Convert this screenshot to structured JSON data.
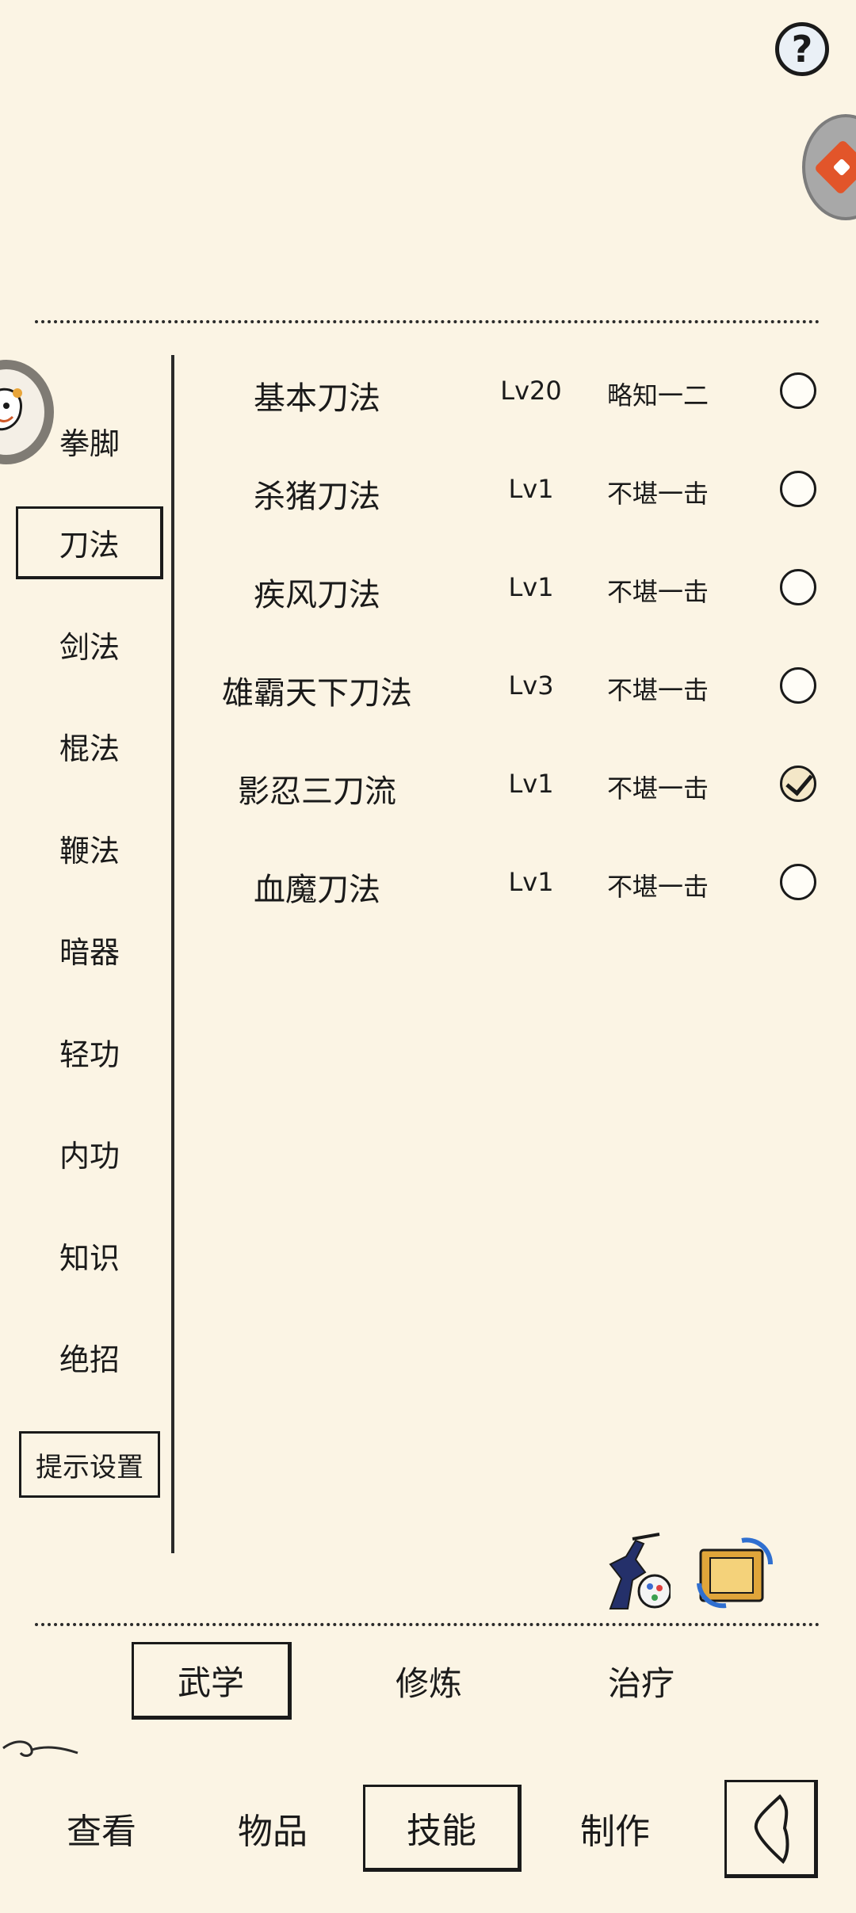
{
  "header": {
    "help_label": "?"
  },
  "categories": [
    {
      "label": "拳脚",
      "selected": false
    },
    {
      "label": "刀法",
      "selected": true
    },
    {
      "label": "剑法",
      "selected": false
    },
    {
      "label": "棍法",
      "selected": false
    },
    {
      "label": "鞭法",
      "selected": false
    },
    {
      "label": "暗器",
      "selected": false
    },
    {
      "label": "轻功",
      "selected": false
    },
    {
      "label": "内功",
      "selected": false
    },
    {
      "label": "知识",
      "selected": false
    },
    {
      "label": "绝招",
      "selected": false
    }
  ],
  "hint_settings_label": "提示设置",
  "skills": [
    {
      "name": "基本刀法",
      "level": "Lv20",
      "mastery": "略知一二",
      "checked": false
    },
    {
      "name": "杀猪刀法",
      "level": "Lv1",
      "mastery": "不堪一击",
      "checked": false
    },
    {
      "name": "疾风刀法",
      "level": "Lv1",
      "mastery": "不堪一击",
      "checked": false
    },
    {
      "name": "雄霸天下刀法",
      "level": "Lv3",
      "mastery": "不堪一击",
      "checked": false
    },
    {
      "name": "影忍三刀流",
      "level": "Lv1",
      "mastery": "不堪一击",
      "checked": true
    },
    {
      "name": "血魔刀法",
      "level": "Lv1",
      "mastery": "不堪一击",
      "checked": false
    }
  ],
  "sub_tabs": [
    {
      "label": "武学",
      "selected": true
    },
    {
      "label": "修炼",
      "selected": false
    },
    {
      "label": "治疗",
      "selected": false
    }
  ],
  "main_tabs": [
    {
      "label": "查看",
      "selected": false
    },
    {
      "label": "物品",
      "selected": false
    },
    {
      "label": "技能",
      "selected": true
    },
    {
      "label": "制作",
      "selected": false
    }
  ],
  "icons": {
    "help": "question-icon",
    "side_widget": "diamond-menu-icon",
    "avatar": "pet-avatar-icon",
    "ninja": "ninja-palette-icon",
    "scroll": "scroll-swap-icon",
    "back": "back-arrow-icon"
  },
  "colors": {
    "background": "#fbf4e4",
    "ink": "#1a1a1a",
    "accent_orange": "#e2552a"
  }
}
